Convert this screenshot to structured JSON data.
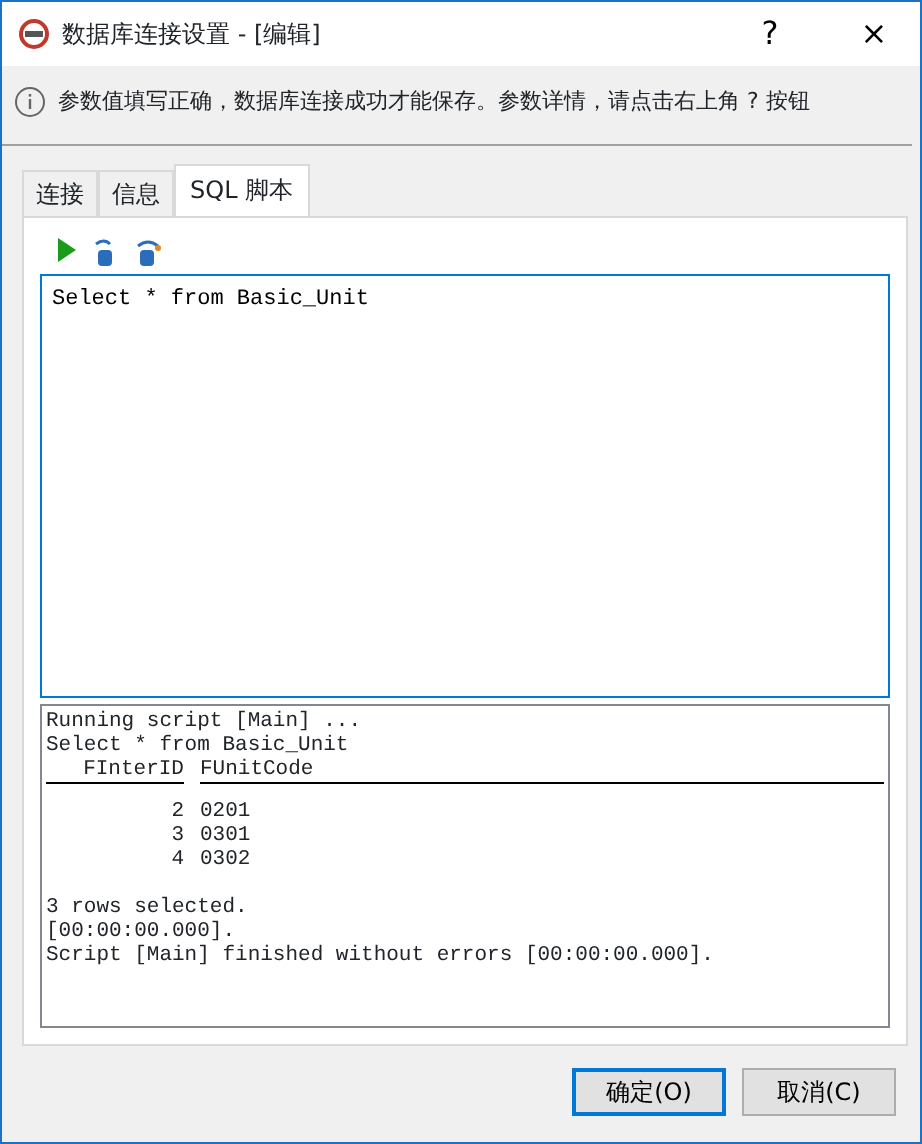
{
  "window": {
    "title": "数据库连接设置 - [编辑]",
    "help": "?",
    "close": "×"
  },
  "info": "参数值填写正确，数据库连接成功才能保存。参数详情，请点击右上角 ? 按钮",
  "tabs": [
    {
      "label": "连接",
      "selected": false
    },
    {
      "label": "信息",
      "selected": false
    },
    {
      "label": "SQL 脚本",
      "selected": true
    }
  ],
  "editor": {
    "value": "Select * from Basic_Unit"
  },
  "output": {
    "before": [
      "Running script [Main] ...",
      "Select * from Basic_Unit"
    ],
    "columns": [
      "FInterID",
      "FUnitCode"
    ],
    "rows": [
      [
        "2",
        "0201"
      ],
      [
        "3",
        "0301"
      ],
      [
        "4",
        "0302"
      ]
    ],
    "after": [
      "3 rows selected.",
      "[00:00:00.000].",
      "Script [Main] finished without errors [00:00:00.000]."
    ]
  },
  "buttons": [
    {
      "label": "确定(O)",
      "default": true
    },
    {
      "label": "取消(C)",
      "default": false
    }
  ]
}
